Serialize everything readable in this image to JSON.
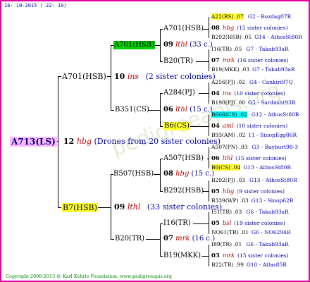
{
  "date": "16- 10-2015 ( 22: 19)",
  "footer": "Copyright 2008-2015 @ Karl Kehrle Foundation.   www.pedigreeapis.org",
  "root": {
    "name": "A713(LS)",
    "num": "12",
    "rel": "hbg",
    "note": "(Drones from 20 sister colonies)"
  },
  "gen1": {
    "upper": {
      "name": "A701(HSB)",
      "num": "10",
      "rel": "ins",
      "note": "(2 sister colonies)"
    },
    "lower": {
      "name": "B7(HSB)",
      "num": "09",
      "rel": "lthl",
      "note": "(33 sister colonies)"
    }
  },
  "gen2": {
    "a": {
      "name": "A701(HSB)",
      "num": "09",
      "rel": "lthl",
      "note": "(33 c.)"
    },
    "b": {
      "name": "B351(CS)",
      "num": "06",
      "rel": "lthl",
      "note": "(15 c.)"
    },
    "c": {
      "name": "B507(HSB)",
      "num": "08",
      "rel": "hbg",
      "note": "(15 c.)"
    },
    "d": {
      "name": "B20(TR)",
      "num": "",
      "rel": "",
      "note": ""
    }
  },
  "gen3": [
    "A701(HSB)",
    "B20(TR)",
    "A284(PJ)",
    "B6(CS)",
    "A507(HSB)",
    "B292(HSB)",
    "I16(TR)",
    "B19(MKK)"
  ],
  "gen3_pairs": [
    {
      "num": "",
      "rel": "",
      "note": ""
    },
    {
      "num": "07",
      "rel": "mrk",
      "note": "(16 c.)"
    }
  ],
  "gen4": [
    {
      "q": "A22(RS) .07",
      "c": "G2 - Bozdag07R",
      "pair": {
        "num": "08",
        "rel": "hbg",
        "note": "(15 sister colonies)"
      },
      "f": "B292(HSB) .05",
      "fc": "G14 - AthosSt80R"
    },
    {
      "q": "I16(TR) .05",
      "c": "G7 - Takab93aR",
      "pair": {
        "num": "07",
        "rel": "mrk",
        "note": "(16 sister colonies)"
      },
      "f": "B19(MKK) .03",
      "fc": "G7 - Takab93aR"
    },
    {
      "q": "A256(PJ) .02",
      "c": "G4 - Cankiri97Q",
      "pair": {
        "num": "04",
        "rel": "ins",
        "note": "(10 sister colonies)"
      },
      "f": "B190(PJ) .00",
      "fc": "G5 - Sardasht93R"
    },
    {
      "q": "B666(CS) .02",
      "c": "G12 - AthosSt80R",
      "pair": {
        "num": "04",
        "rel": "aml",
        "note": "(10 sister colonies)"
      },
      "f": "B93(AM) .02",
      "fc": "11 - SinopEgg86R"
    },
    {
      "q": "A507(PN) .03",
      "c": "G3 - Bayburt98-3",
      "pair": {
        "num": "06",
        "rel": "lthl",
        "note": "(15 sister colonies)"
      },
      "f": "B6(CS) .04",
      "fc": "G13 - AthosSt80R"
    },
    {
      "q": "B292(PJ) .03",
      "c": "G13 - AthosSt80R",
      "pair": {
        "num": "05",
        "rel": "hbg",
        "note": "(9 sister colonies)"
      },
      "f": "B339(WP) .03",
      "fc": "G13 - Sinop62R"
    },
    {
      "q": "I51(TR) .03",
      "c": "G6 - Takab93aR",
      "pair": {
        "num": "05",
        "rel": "bsl",
        "note": "(19 sister colonies)"
      },
      "f": "NO61(TR) .01",
      "fc": "G6 - NO6294R"
    },
    {
      "q": "I89(TR) .01",
      "c": "G6 - Takab93aR",
      "pair": {
        "num": "03",
        "rel": "mrk",
        "note": "(15 sister colonies)"
      },
      "f": "B22(TR) .99",
      "fc": "G10 - Atlas85R"
    }
  ],
  "watermark": "pedigreeapis.org"
}
